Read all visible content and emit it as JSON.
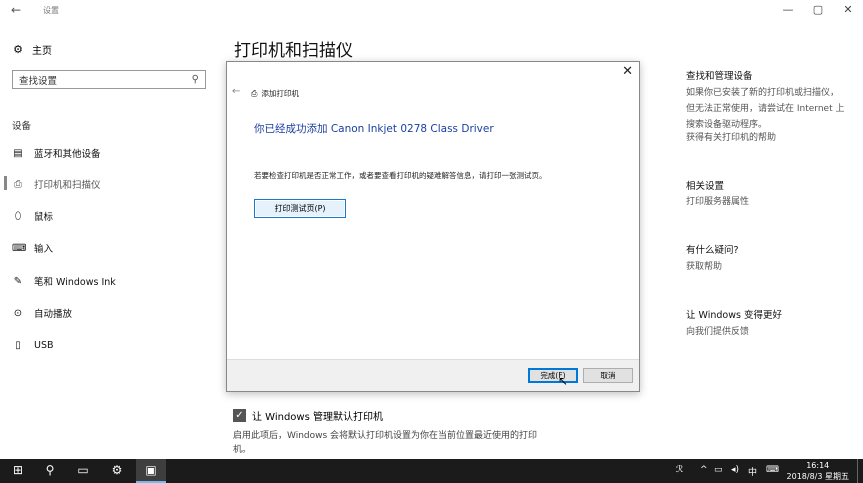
{
  "window": {
    "back_icon": "←",
    "title": "设置",
    "minimize": "—",
    "maximize": "▢",
    "close": "✕"
  },
  "sidebar": {
    "home_label": "主页",
    "search_placeholder": "查找设置",
    "section_label": "设备",
    "items": [
      {
        "label": "蓝牙和其他设备",
        "icon": "bluetooth-device-icon"
      },
      {
        "label": "打印机和扫描仪",
        "icon": "printer-icon"
      },
      {
        "label": "鼠标",
        "icon": "mouse-icon"
      },
      {
        "label": "输入",
        "icon": "keyboard-icon"
      },
      {
        "label": "笔和 Windows Ink",
        "icon": "pen-icon"
      },
      {
        "label": "自动播放",
        "icon": "autoplay-icon"
      },
      {
        "label": "USB",
        "icon": "usb-icon"
      }
    ]
  },
  "main": {
    "title": "打印机和扫描仪",
    "checkbox_label": "让 Windows 管理默认打印机",
    "checkbox_checked": true,
    "checkbox_description": "启用此项后，Windows 会将默认打印机设置为你在当前位置最近使用的打印机。"
  },
  "right_panel": {
    "sections": [
      {
        "heading": "查找和管理设备",
        "text": "如果你已安装了新的打印机或扫描仪，但无法正常使用，请尝试在 Internet 上搜索设备驱动程序。",
        "link": "获得有关打印机的帮助"
      },
      {
        "heading": "相关设置",
        "link": "打印服务器属性"
      },
      {
        "heading": "有什么疑问?",
        "link": "获取帮助"
      },
      {
        "heading": "让 Windows 变得更好",
        "link": "向我们提供反馈"
      }
    ]
  },
  "dialog": {
    "close": "✕",
    "back": "←",
    "title": "添加打印机",
    "success_message": "你已经成功添加 Canon Inkjet 0278 Class Driver",
    "instruction": "若要检查打印机是否正常工作，或者要查看打印机的疑难解答信息，请打印一张测试页。",
    "test_page_button": "打印测试页(P)",
    "finish_button": "完成(F)",
    "cancel_button": "取消"
  },
  "taskbar": {
    "time": "16:14",
    "date": "2018/8/3 星期五",
    "ime": "中",
    "tray_icons": [
      "network-icon",
      "up-arrow-icon",
      "wifi-icon",
      "volume-icon",
      "ime-icon",
      "keyboard-icon"
    ]
  }
}
